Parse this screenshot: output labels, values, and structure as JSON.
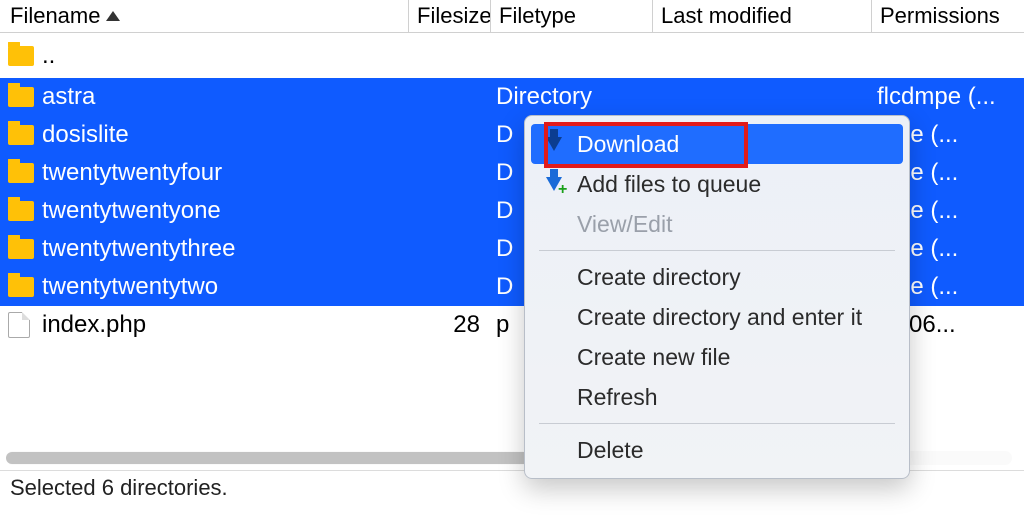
{
  "columns": {
    "filename": "Filename",
    "filesize": "Filesize",
    "filetype": "Filetype",
    "lastmod": "Last modified",
    "permissions": "Permissions"
  },
  "rows": {
    "updir": "..",
    "r0": {
      "name": "astra",
      "size": "",
      "type": "Directory",
      "perm": "flcdmpe (..."
    },
    "r1": {
      "name": "dosislite",
      "size": "",
      "type": "D",
      "perm": "mpe (..."
    },
    "r2": {
      "name": "twentytwentyfour",
      "size": "",
      "type": "D",
      "perm": "mpe (..."
    },
    "r3": {
      "name": "twentytwentyone",
      "size": "",
      "type": "D",
      "perm": "mpe (..."
    },
    "r4": {
      "name": "twentytwentythree",
      "size": "",
      "type": "D",
      "perm": "mpe (..."
    },
    "r5": {
      "name": "twentytwentytwo",
      "size": "",
      "type": "D",
      "perm": "mpe (..."
    },
    "r6": {
      "name": "index.php",
      "size": "28",
      "type": "p",
      "perm": "w (06..."
    }
  },
  "status": "Selected 6 directories.",
  "menu": {
    "download": "Download",
    "add_queue": "Add files to queue",
    "view_edit": "View/Edit",
    "create_dir": "Create directory",
    "create_dir_enter": "Create directory and enter it",
    "create_file": "Create new file",
    "refresh": "Refresh",
    "delete": "Delete"
  }
}
